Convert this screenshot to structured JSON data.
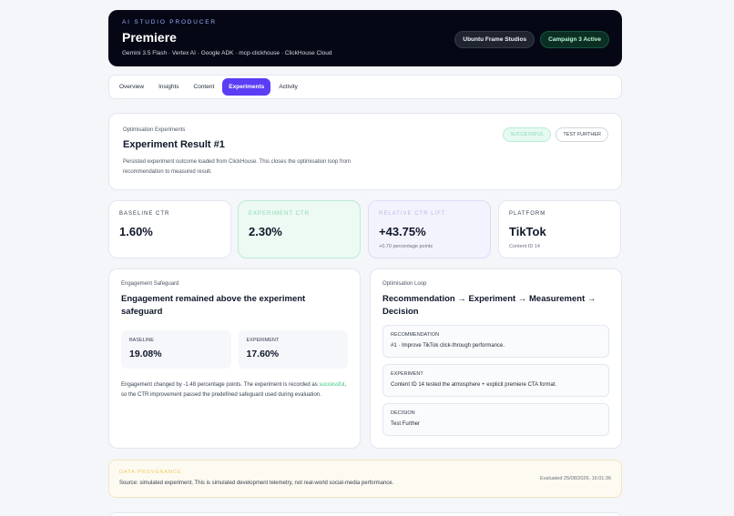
{
  "header": {
    "eyebrow": "AI STUDIO PRODUCER",
    "title": "Premiere",
    "subtitle": "Gemini 3.5 Flash · Vertex AI · Google ADK · mcp-clickhouse · ClickHouse Cloud",
    "badges": [
      "Ubuntu Frame Studios",
      "Campaign 3 Active"
    ]
  },
  "tabs": [
    {
      "label": "Overview"
    },
    {
      "label": "Insights"
    },
    {
      "label": "Content"
    },
    {
      "label": "Experiments",
      "active": true
    },
    {
      "label": "Activity"
    }
  ],
  "experiment": {
    "section_label": "Optimisation Experiments",
    "title": "Experiment Result #1",
    "description": "Persisted experiment outcome loaded from ClickHouse. This closes the optimisation loop from recommendation to measured result.",
    "status_success": "SUCCESSFUL",
    "status_next": "TEST FURTHER"
  },
  "metrics": [
    {
      "label": "BASELINE CTR",
      "value": "1.60%",
      "note": ""
    },
    {
      "label": "EXPERIMENT CTR",
      "value": "2.30%",
      "note": ""
    },
    {
      "label": "RELATIVE CTR LIFT",
      "value": "+43.75%",
      "note": "+0.70 percentage points"
    },
    {
      "label": "PLATFORM",
      "value": "TikTok",
      "note": "Content ID 14"
    }
  ],
  "safeguard": {
    "section_label": "Engagement Safeguard",
    "title": "Engagement remained above the experiment safeguard",
    "baseline_label": "BASELINE",
    "baseline_value": "19.08%",
    "experiment_label": "EXPERIMENT",
    "experiment_value": "17.60%",
    "desc_before": "Engagement changed by -1.48 percentage points. The experiment is recorded as ",
    "desc_highlight": "successful",
    "desc_after": ", so the CTR improvement passed the predefined safeguard used during evaluation."
  },
  "loop": {
    "section_label": "Optimisation Loop",
    "title": "Recommendation → Experiment → Measurement → Decision",
    "steps": [
      {
        "label": "RECOMMENDATION",
        "value": "#1 · Improve TikTok click-through performance."
      },
      {
        "label": "EXPERIMENT",
        "value": "Content ID 14 tested the atmosphere + explicit premiere CTA format."
      },
      {
        "label": "DECISION",
        "value": "Test Further"
      }
    ]
  },
  "provenance": {
    "label": "DATA PROVENANCE",
    "text": "Source: simulated experiment. This is simulated development telemetry, not real-world social-media performance.",
    "timestamp": "Evaluated 25/08/2026, 16:01:36"
  },
  "colors": {
    "accent": "#5b3df5",
    "hero_bg": "#050814",
    "success": "#34c77b",
    "warning": "#f0c95c"
  }
}
